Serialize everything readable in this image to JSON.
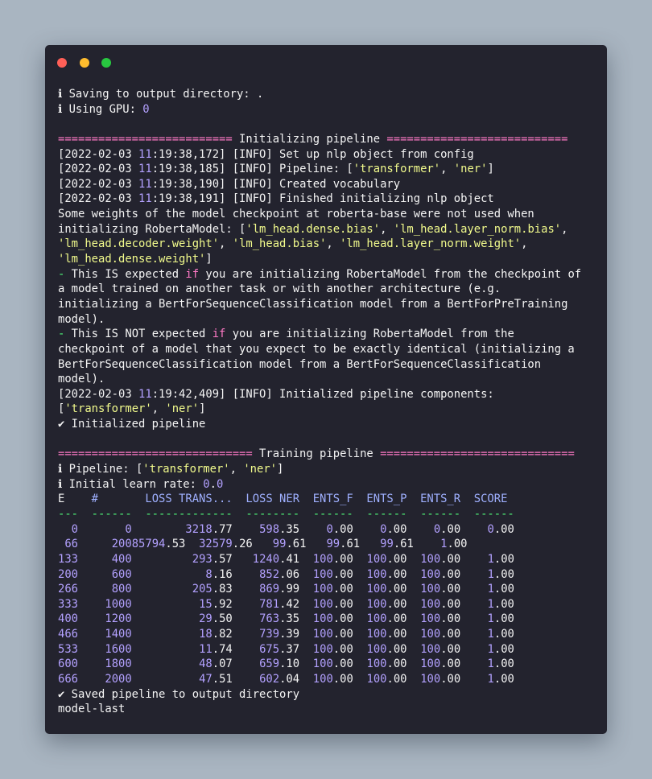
{
  "window": {
    "controls": [
      "close-dot",
      "minimize-dot",
      "maximize-dot"
    ],
    "colors": {
      "close": "#ff5f57",
      "minimize": "#febc2e",
      "maximize": "#28c840",
      "background": "#23232e"
    }
  },
  "palette": {
    "text": "#f4f4f4",
    "rule": "#ff79c6",
    "string": "#f1fa8c",
    "number": "#b3a1ff",
    "keyword": "#ff79c6",
    "dash": "#50fa7b",
    "header": "#9fb0ff"
  },
  "lines": [
    [
      {
        "t": "ℹ Saving to output directory: ."
      }
    ],
    [
      {
        "t": "ℹ Using GPU: "
      },
      {
        "t": "0",
        "c": "pu"
      }
    ],
    [],
    [
      {
        "t": "========================== ",
        "c": "pk"
      },
      {
        "t": "Initializing pipeline"
      },
      {
        "t": " ===========================",
        "c": "pk"
      }
    ],
    [
      {
        "t": "[2022-02-03 "
      },
      {
        "t": "11",
        "c": "pu"
      },
      {
        "t": ":19:38,172] [INFO] Set up nlp object from config"
      }
    ],
    [
      {
        "t": "[2022-02-03 "
      },
      {
        "t": "11",
        "c": "pu"
      },
      {
        "t": ":19:38,185] [INFO] Pipeline: ["
      },
      {
        "t": "'transformer'",
        "c": "yl"
      },
      {
        "t": ", "
      },
      {
        "t": "'ner'",
        "c": "yl"
      },
      {
        "t": "]"
      }
    ],
    [
      {
        "t": "[2022-02-03 "
      },
      {
        "t": "11",
        "c": "pu"
      },
      {
        "t": ":19:38,190] [INFO] Created vocabulary"
      }
    ],
    [
      {
        "t": "[2022-02-03 "
      },
      {
        "t": "11",
        "c": "pu"
      },
      {
        "t": ":19:38,191] [INFO] Finished initializing nlp object"
      }
    ],
    [
      {
        "t": "Some weights of the model checkpoint at roberta-base were not used when"
      }
    ],
    [
      {
        "t": "initializing RobertaModel: ["
      },
      {
        "t": "'lm_head.dense.bias'",
        "c": "yl"
      },
      {
        "t": ", "
      },
      {
        "t": "'lm_head.layer_norm.bias'",
        "c": "yl"
      },
      {
        "t": ","
      }
    ],
    [
      {
        "t": "'lm_head.decoder.weight'",
        "c": "yl"
      },
      {
        "t": ", "
      },
      {
        "t": "'lm_head.bias'",
        "c": "yl"
      },
      {
        "t": ", "
      },
      {
        "t": "'lm_head.layer_norm.weight'",
        "c": "yl"
      },
      {
        "t": ","
      }
    ],
    [
      {
        "t": "'lm_head.dense.weight'",
        "c": "yl"
      },
      {
        "t": "]"
      }
    ],
    [
      {
        "t": "-",
        "c": "gr"
      },
      {
        "t": " This IS expected "
      },
      {
        "t": "if",
        "c": "pk"
      },
      {
        "t": " you are initializing RobertaModel from the checkpoint of"
      }
    ],
    [
      {
        "t": "a model trained on another task or with another architecture (e.g."
      }
    ],
    [
      {
        "t": "initializing a BertForSequenceClassification model from a BertForPreTraining"
      }
    ],
    [
      {
        "t": "model)."
      }
    ],
    [
      {
        "t": "-",
        "c": "gr"
      },
      {
        "t": " This IS NOT expected "
      },
      {
        "t": "if",
        "c": "pk"
      },
      {
        "t": " you are initializing RobertaModel from the"
      }
    ],
    [
      {
        "t": "checkpoint of a model that you expect to be exactly identical (initializing a"
      }
    ],
    [
      {
        "t": "BertForSequenceClassification model from a BertForSequenceClassification"
      }
    ],
    [
      {
        "t": "model)."
      }
    ],
    [
      {
        "t": "[2022-02-03 "
      },
      {
        "t": "11",
        "c": "pu"
      },
      {
        "t": ":19:42,409] [INFO] Initialized pipeline components:"
      }
    ],
    [
      {
        "t": "["
      },
      {
        "t": "'transformer'",
        "c": "yl"
      },
      {
        "t": ", "
      },
      {
        "t": "'ner'",
        "c": "yl"
      },
      {
        "t": "]"
      }
    ],
    [
      {
        "t": "✔ Initialized pipeline"
      }
    ],
    [],
    [
      {
        "t": "============================= ",
        "c": "pk"
      },
      {
        "t": "Training pipeline"
      },
      {
        "t": " =============================",
        "c": "pk"
      }
    ],
    [
      {
        "t": "ℹ Pipeline: ["
      },
      {
        "t": "'transformer'",
        "c": "yl"
      },
      {
        "t": ", "
      },
      {
        "t": "'ner'",
        "c": "yl"
      },
      {
        "t": "]"
      }
    ],
    [
      {
        "t": "ℹ Initial learn rate: "
      },
      {
        "t": "0",
        "c": "pu"
      },
      {
        "t": "."
      },
      {
        "t": "0",
        "c": "pu"
      }
    ],
    [
      {
        "t": "E"
      },
      {
        "t": "    #       LOSS TRANS...  LOSS NER  ENTS_F  ENTS_P  ENTS_R  SCORE ",
        "c": "hd"
      }
    ],
    [
      {
        "t": "---  ------  -------------  --------  ------  ------  ------  ------",
        "c": "gr"
      }
    ],
    [
      {
        "t": "  "
      },
      {
        "t": "0",
        "c": "pu"
      },
      {
        "t": "       "
      },
      {
        "t": "0",
        "c": "pu"
      },
      {
        "t": "        "
      },
      {
        "t": "3218",
        "c": "pu"
      },
      {
        "t": ".77    "
      },
      {
        "t": "598",
        "c": "pu"
      },
      {
        "t": ".35    "
      },
      {
        "t": "0",
        "c": "pu"
      },
      {
        "t": ".00    "
      },
      {
        "t": "0",
        "c": "pu"
      },
      {
        "t": ".00    "
      },
      {
        "t": "0",
        "c": "pu"
      },
      {
        "t": ".00    "
      },
      {
        "t": "0",
        "c": "pu"
      },
      {
        "t": ".00"
      }
    ],
    [
      {
        "t": " "
      },
      {
        "t": "66",
        "c": "pu"
      },
      {
        "t": "     "
      },
      {
        "t": "20085794",
        "c": "pu"
      },
      {
        "t": ".53  "
      },
      {
        "t": "32579",
        "c": "pu"
      },
      {
        "t": ".26   "
      },
      {
        "t": "99",
        "c": "pu"
      },
      {
        "t": ".61   "
      },
      {
        "t": "99",
        "c": "pu"
      },
      {
        "t": ".61   "
      },
      {
        "t": "99",
        "c": "pu"
      },
      {
        "t": ".61    "
      },
      {
        "t": "1",
        "c": "pu"
      },
      {
        "t": ".00"
      }
    ],
    [
      {
        "t": "133",
        "c": "pu"
      },
      {
        "t": "     "
      },
      {
        "t": "400",
        "c": "pu"
      },
      {
        "t": "         "
      },
      {
        "t": "293",
        "c": "pu"
      },
      {
        "t": ".57   "
      },
      {
        "t": "1240",
        "c": "pu"
      },
      {
        "t": ".41  "
      },
      {
        "t": "100",
        "c": "pu"
      },
      {
        "t": ".00  "
      },
      {
        "t": "100",
        "c": "pu"
      },
      {
        "t": ".00  "
      },
      {
        "t": "100",
        "c": "pu"
      },
      {
        "t": ".00    "
      },
      {
        "t": "1",
        "c": "pu"
      },
      {
        "t": ".00"
      }
    ],
    [
      {
        "t": "200",
        "c": "pu"
      },
      {
        "t": "     "
      },
      {
        "t": "600",
        "c": "pu"
      },
      {
        "t": "           "
      },
      {
        "t": "8",
        "c": "pu"
      },
      {
        "t": ".16    "
      },
      {
        "t": "852",
        "c": "pu"
      },
      {
        "t": ".06  "
      },
      {
        "t": "100",
        "c": "pu"
      },
      {
        "t": ".00  "
      },
      {
        "t": "100",
        "c": "pu"
      },
      {
        "t": ".00  "
      },
      {
        "t": "100",
        "c": "pu"
      },
      {
        "t": ".00    "
      },
      {
        "t": "1",
        "c": "pu"
      },
      {
        "t": ".00"
      }
    ],
    [
      {
        "t": "266",
        "c": "pu"
      },
      {
        "t": "     "
      },
      {
        "t": "800",
        "c": "pu"
      },
      {
        "t": "         "
      },
      {
        "t": "205",
        "c": "pu"
      },
      {
        "t": ".83    "
      },
      {
        "t": "869",
        "c": "pu"
      },
      {
        "t": ".99  "
      },
      {
        "t": "100",
        "c": "pu"
      },
      {
        "t": ".00  "
      },
      {
        "t": "100",
        "c": "pu"
      },
      {
        "t": ".00  "
      },
      {
        "t": "100",
        "c": "pu"
      },
      {
        "t": ".00    "
      },
      {
        "t": "1",
        "c": "pu"
      },
      {
        "t": ".00"
      }
    ],
    [
      {
        "t": "333",
        "c": "pu"
      },
      {
        "t": "    "
      },
      {
        "t": "1000",
        "c": "pu"
      },
      {
        "t": "          "
      },
      {
        "t": "15",
        "c": "pu"
      },
      {
        "t": ".92    "
      },
      {
        "t": "781",
        "c": "pu"
      },
      {
        "t": ".42  "
      },
      {
        "t": "100",
        "c": "pu"
      },
      {
        "t": ".00  "
      },
      {
        "t": "100",
        "c": "pu"
      },
      {
        "t": ".00  "
      },
      {
        "t": "100",
        "c": "pu"
      },
      {
        "t": ".00    "
      },
      {
        "t": "1",
        "c": "pu"
      },
      {
        "t": ".00"
      }
    ],
    [
      {
        "t": "400",
        "c": "pu"
      },
      {
        "t": "    "
      },
      {
        "t": "1200",
        "c": "pu"
      },
      {
        "t": "          "
      },
      {
        "t": "29",
        "c": "pu"
      },
      {
        "t": ".50    "
      },
      {
        "t": "763",
        "c": "pu"
      },
      {
        "t": ".35  "
      },
      {
        "t": "100",
        "c": "pu"
      },
      {
        "t": ".00  "
      },
      {
        "t": "100",
        "c": "pu"
      },
      {
        "t": ".00  "
      },
      {
        "t": "100",
        "c": "pu"
      },
      {
        "t": ".00    "
      },
      {
        "t": "1",
        "c": "pu"
      },
      {
        "t": ".00"
      }
    ],
    [
      {
        "t": "466",
        "c": "pu"
      },
      {
        "t": "    "
      },
      {
        "t": "1400",
        "c": "pu"
      },
      {
        "t": "          "
      },
      {
        "t": "18",
        "c": "pu"
      },
      {
        "t": ".82    "
      },
      {
        "t": "739",
        "c": "pu"
      },
      {
        "t": ".39  "
      },
      {
        "t": "100",
        "c": "pu"
      },
      {
        "t": ".00  "
      },
      {
        "t": "100",
        "c": "pu"
      },
      {
        "t": ".00  "
      },
      {
        "t": "100",
        "c": "pu"
      },
      {
        "t": ".00    "
      },
      {
        "t": "1",
        "c": "pu"
      },
      {
        "t": ".00"
      }
    ],
    [
      {
        "t": "533",
        "c": "pu"
      },
      {
        "t": "    "
      },
      {
        "t": "1600",
        "c": "pu"
      },
      {
        "t": "          "
      },
      {
        "t": "11",
        "c": "pu"
      },
      {
        "t": ".74    "
      },
      {
        "t": "675",
        "c": "pu"
      },
      {
        "t": ".37  "
      },
      {
        "t": "100",
        "c": "pu"
      },
      {
        "t": ".00  "
      },
      {
        "t": "100",
        "c": "pu"
      },
      {
        "t": ".00  "
      },
      {
        "t": "100",
        "c": "pu"
      },
      {
        "t": ".00    "
      },
      {
        "t": "1",
        "c": "pu"
      },
      {
        "t": ".00"
      }
    ],
    [
      {
        "t": "600",
        "c": "pu"
      },
      {
        "t": "    "
      },
      {
        "t": "1800",
        "c": "pu"
      },
      {
        "t": "          "
      },
      {
        "t": "48",
        "c": "pu"
      },
      {
        "t": ".07    "
      },
      {
        "t": "659",
        "c": "pu"
      },
      {
        "t": ".10  "
      },
      {
        "t": "100",
        "c": "pu"
      },
      {
        "t": ".00  "
      },
      {
        "t": "100",
        "c": "pu"
      },
      {
        "t": ".00  "
      },
      {
        "t": "100",
        "c": "pu"
      },
      {
        "t": ".00    "
      },
      {
        "t": "1",
        "c": "pu"
      },
      {
        "t": ".00"
      }
    ],
    [
      {
        "t": "666",
        "c": "pu"
      },
      {
        "t": "    "
      },
      {
        "t": "2000",
        "c": "pu"
      },
      {
        "t": "          "
      },
      {
        "t": "47",
        "c": "pu"
      },
      {
        "t": ".51    "
      },
      {
        "t": "602",
        "c": "pu"
      },
      {
        "t": ".04  "
      },
      {
        "t": "100",
        "c": "pu"
      },
      {
        "t": ".00  "
      },
      {
        "t": "100",
        "c": "pu"
      },
      {
        "t": ".00  "
      },
      {
        "t": "100",
        "c": "pu"
      },
      {
        "t": ".00    "
      },
      {
        "t": "1",
        "c": "pu"
      },
      {
        "t": ".00"
      }
    ],
    [
      {
        "t": "✔ Saved pipeline to output directory"
      }
    ],
    [
      {
        "t": "model-last"
      }
    ]
  ]
}
